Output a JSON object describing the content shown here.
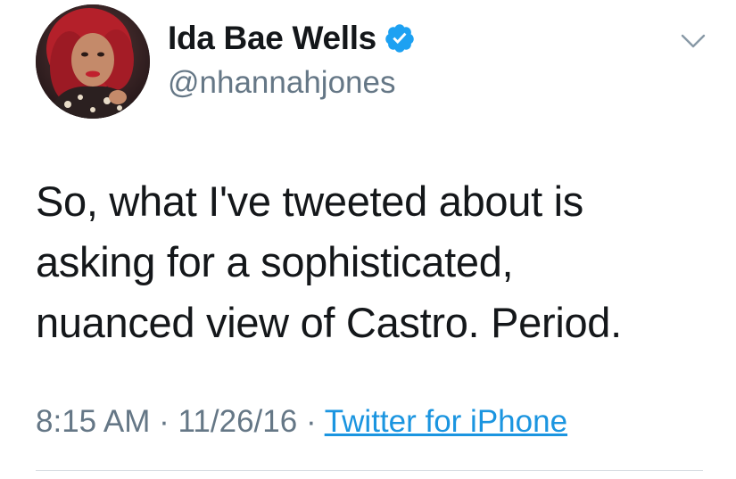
{
  "user": {
    "display_name": "Ida Bae Wells",
    "handle": "@nhannahjones",
    "verified_icon": "verified-badge-icon",
    "avatar": "profile-avatar"
  },
  "menu": {
    "icon": "chevron-down-icon"
  },
  "tweet": {
    "lines": [
      "So, what I've tweeted about is",
      "asking for a sophisticated,",
      "nuanced view of Castro. Period."
    ]
  },
  "meta": {
    "time": "8:15 AM",
    "separator": "·",
    "date": "11/26/16",
    "source": "Twitter for iPhone"
  },
  "colors": {
    "verified_blue": "#1da1f2",
    "link_blue": "#1b95e0",
    "secondary_text": "#657786",
    "primary_text": "#14171a",
    "divider": "#d8dde2"
  }
}
